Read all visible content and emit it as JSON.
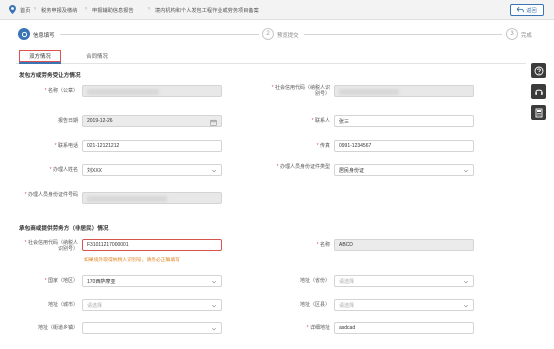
{
  "breadcrumb": {
    "items": [
      "首页",
      "税务申报及缴纳",
      "申报辅助信息报告",
      "境内机构和个人发包工程作业或劳务项目备案"
    ]
  },
  "back_button": {
    "label": "返回",
    "icon": "undo-icon"
  },
  "steps": [
    {
      "number": "1",
      "label": "信息填写",
      "state": "active"
    },
    {
      "number": "2",
      "label": "预览提交",
      "state": "pending"
    },
    {
      "number": "3",
      "label": "完成",
      "state": "pending"
    }
  ],
  "tabs": [
    {
      "label": "双方情况",
      "active": true
    },
    {
      "label": "合同情况",
      "active": false
    }
  ],
  "section1": {
    "title": "发包方或劳务受让方情况",
    "fields": {
      "name_label": "名称（公章）",
      "credit_code_label": "社会信用代码（纳税人识别号）",
      "report_date_label": "报告日期",
      "report_date_value": "2019-12-26",
      "contact_label": "联系人",
      "contact_value": "张三",
      "phone_label": "联系电话",
      "phone_value": "021-12121212",
      "fax_label": "传真",
      "fax_value": "0991-1234567",
      "handler_name_label": "办理人姓名",
      "handler_name_value": "刘XXX",
      "handler_id_type_label": "办理人员身份证件类型",
      "handler_id_type_value": "居民身份证",
      "handler_id_no_label": "办理人员身份证件号码"
    }
  },
  "section2": {
    "title": "承包商或提供劳务方（非居民）情况",
    "fields": {
      "credit_code_label": "社会信用代码（纳税人识别号）",
      "credit_code_value": "F31011217000001",
      "name_label": "名称",
      "name_value": "ABCD",
      "hint": "如果境外取得纳税人识别号，请务必正确填写",
      "country_label": "国家（地区）",
      "country_value": "170西萨摩亚",
      "address_label": "地址（省份）",
      "address_placeholder": "请选择",
      "city_label": "地址（城市）",
      "city_placeholder": "请选择",
      "district_label": "地址（区县）",
      "district_placeholder": "请选择",
      "street_label": "地址（街道乡镇）",
      "detail_label": "详细地址",
      "detail_value": "asdcad"
    }
  },
  "side_tools": [
    {
      "icon": "help-icon"
    },
    {
      "icon": "headset-icon"
    },
    {
      "icon": "calculator-icon"
    }
  ],
  "colors": {
    "accent": "#3a74b5",
    "error": "#d9534f",
    "hint": "#e0882a"
  }
}
